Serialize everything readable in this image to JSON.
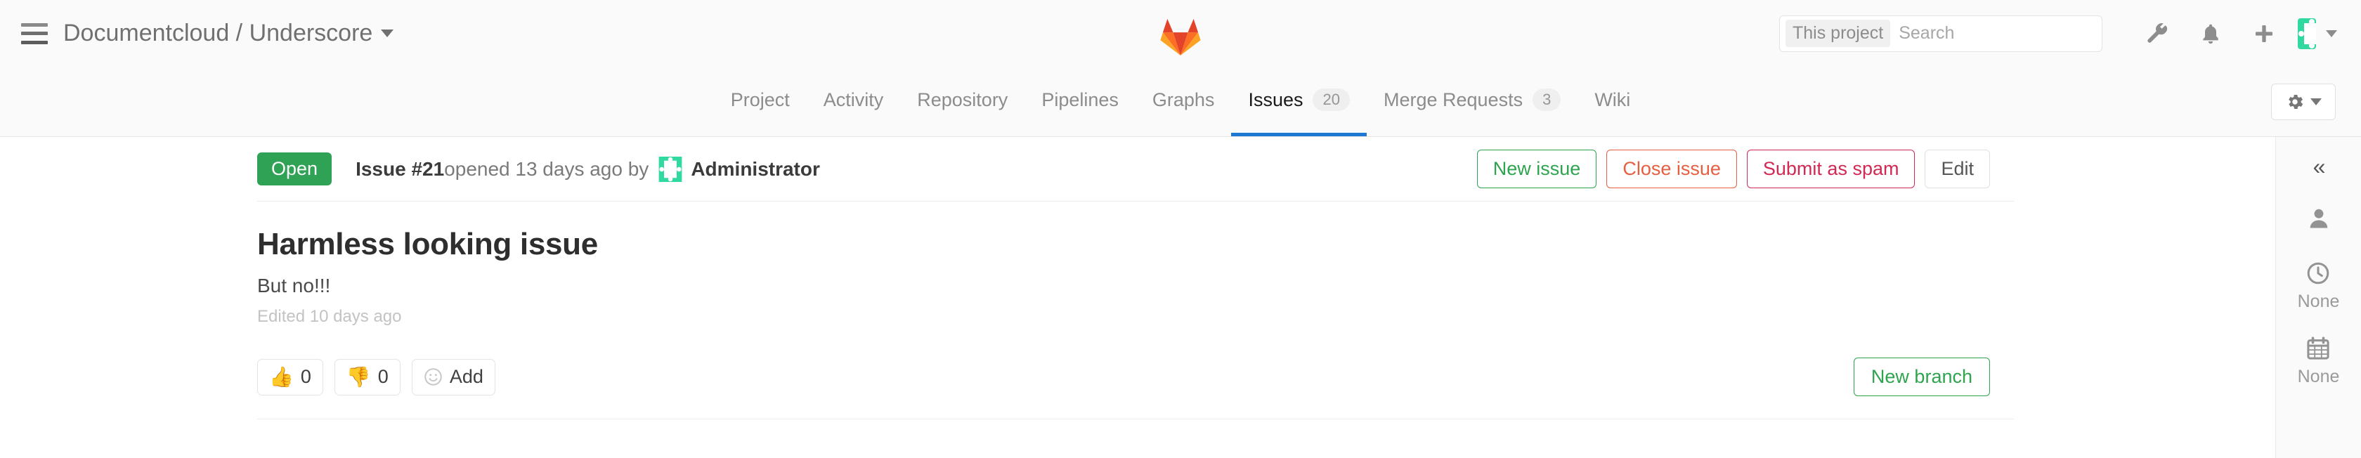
{
  "navbar": {
    "menu_icon": "hamburger-icon",
    "breadcrumb": "Documentcloud / Underscore",
    "logo": "gitlab-logo",
    "search": {
      "scope_label": "This project",
      "placeholder": "Search",
      "value": "",
      "icon": "search-icon"
    },
    "icons": [
      {
        "name": "wrench-icon",
        "label": "Admin area"
      },
      {
        "name": "bell-icon",
        "label": "Todos"
      },
      {
        "name": "plus-icon",
        "label": "New"
      }
    ],
    "user": {
      "avatar": "user-avatar",
      "caret": "chevron-down-icon"
    }
  },
  "subnav": {
    "tabs": [
      {
        "label": "Project",
        "badge": "",
        "active": false
      },
      {
        "label": "Activity",
        "badge": "",
        "active": false
      },
      {
        "label": "Repository",
        "badge": "",
        "active": false
      },
      {
        "label": "Pipelines",
        "badge": "",
        "active": false
      },
      {
        "label": "Graphs",
        "badge": "",
        "active": false
      },
      {
        "label": "Issues",
        "badge": "20",
        "active": true
      },
      {
        "label": "Merge Requests",
        "badge": "3",
        "active": false
      },
      {
        "label": "Wiki",
        "badge": "",
        "active": false
      }
    ],
    "settings": {
      "icon": "gear-icon",
      "caret": "chevron-down-icon"
    }
  },
  "issue": {
    "state": "Open",
    "number_label": "Issue #21",
    "opened_text": " opened 13 days ago by ",
    "author": "Administrator",
    "author_avatar": "author-avatar",
    "title": "Harmless looking issue",
    "description": "But no!!!",
    "edited": "Edited 10 days ago",
    "actions": [
      {
        "label": "New issue",
        "style": "green"
      },
      {
        "label": "Close issue",
        "style": "orange"
      },
      {
        "label": "Submit as spam",
        "style": "pink"
      },
      {
        "label": "Edit",
        "style": "gray"
      }
    ],
    "awards": [
      {
        "emoji": "👍",
        "icon_name": "thumbs-up-icon",
        "count": "0"
      },
      {
        "emoji": "👎",
        "icon_name": "thumbs-down-icon",
        "count": "0"
      }
    ],
    "add_award": {
      "label": "Add",
      "icon_name": "smiley-icon"
    },
    "new_branch": "New branch"
  },
  "sidebar": {
    "collapse_icon": "«",
    "items": [
      {
        "icon": "person-icon",
        "label": ""
      },
      {
        "icon": "clock-icon",
        "label": "None"
      },
      {
        "icon": "calendar-icon",
        "label": "None"
      }
    ]
  },
  "colors": {
    "state_green": "#30a256",
    "accent_blue": "#1f78d1",
    "danger_orange": "#e75e40",
    "spam_pink": "#d22853",
    "navbar_bg": "#fafafa"
  }
}
